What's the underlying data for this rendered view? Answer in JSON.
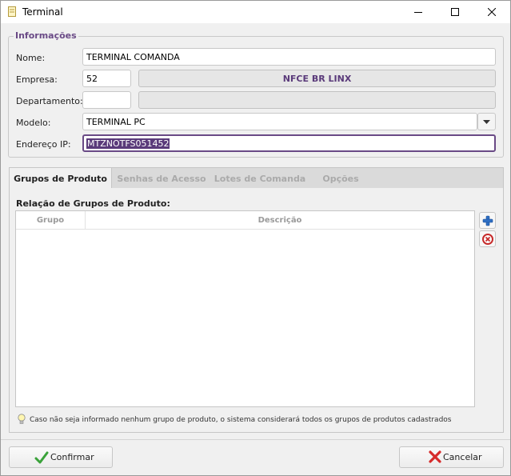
{
  "window": {
    "title": "Terminal"
  },
  "informacoes": {
    "title": "Informações",
    "nome": {
      "label": "Nome:",
      "value": "TERMINAL COMANDA"
    },
    "empresa": {
      "label": "Empresa:",
      "code": "52",
      "name": "NFCE BR LINX"
    },
    "departamento": {
      "label": "Departamento:",
      "code": "",
      "name": ""
    },
    "modelo": {
      "label": "Modelo:",
      "value": "TERMINAL PC"
    },
    "endereco_ip": {
      "label": "Endereço IP:",
      "value": "MTZNOTFS051452"
    }
  },
  "tabs": [
    {
      "label": "Grupos de Produto",
      "active": true
    },
    {
      "label": "Senhas de Acesso",
      "active": false
    },
    {
      "label": "Lotes de Comanda",
      "active": false
    },
    {
      "label": "Opções",
      "active": false
    }
  ],
  "grupos": {
    "title": "Relação de Grupos de Produto:",
    "columns": [
      "Grupo",
      "Descrição"
    ],
    "rows": [],
    "hint": "Caso não seja informado nenhum grupo de produto, o sistema considerará todos os grupos de produtos cadastrados"
  },
  "footer": {
    "confirm_label": "Confirmar",
    "cancel_label": "Cancelar"
  },
  "colors": {
    "accent": "#6a4a86",
    "selection": "#5a3a7a"
  }
}
